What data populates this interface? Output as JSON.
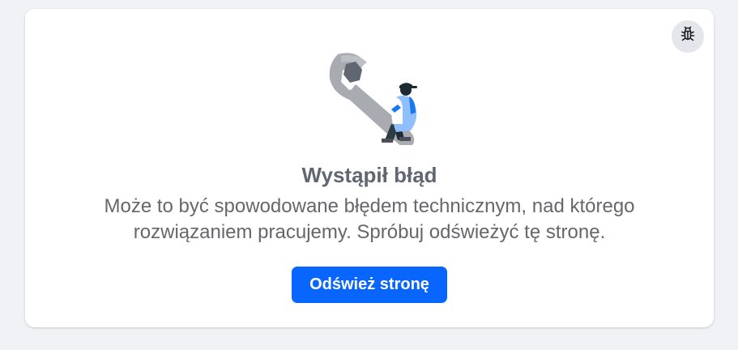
{
  "error": {
    "title": "Wystąpił błąd",
    "message": "Może to być spowodowane błędem technicznym, nad którego rozwiązaniem pracujemy. Spróbuj odświeżyć tę stronę.",
    "refresh_label": "Odśwież stronę"
  },
  "icons": {
    "report": "bug-icon",
    "illustration": "wrench-mechanic-illustration"
  },
  "colors": {
    "primary_button": "#0866ff",
    "page_background": "#f0f2f5",
    "card_background": "#ffffff"
  }
}
